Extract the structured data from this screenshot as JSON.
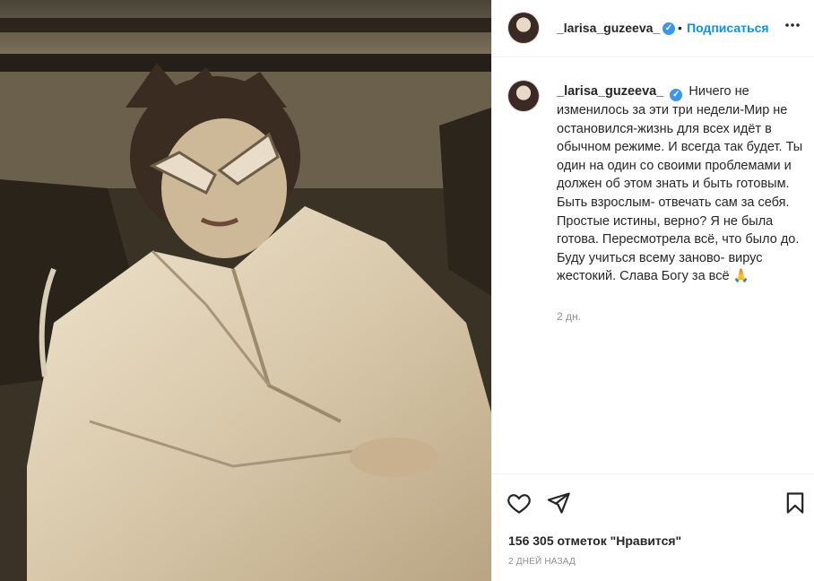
{
  "post": {
    "author": {
      "username": "_larisa_guzeeva_",
      "verified_glyph": "✓",
      "separator": "•",
      "follow_label": "Подписаться",
      "more_label": "•••"
    },
    "caption": {
      "username": "_larisa_guzeeva_",
      "text": "Ничего не изменилось за эти три недели-Мир не остановился-жизнь для всех идёт в обычном режиме. И всегда так будет. Ты один на один со своими проблемами и должен об этом знать и быть готовым. Быть взрослым- отвечать сам за себя. Простые истины, верно? Я не была готова. Пересмотрела всё, что было до. Буду учиться всему заново- вирус жестокий. Слава Богу за всё 🙏",
      "time_ago": "2 дн."
    },
    "actions": {
      "like_icon": "heart-icon",
      "share_icon": "paper-plane-icon",
      "save_icon": "bookmark-icon"
    },
    "likes_text": "156 305 отметок \"Нравится\"",
    "date_text": "2 дней назад"
  },
  "colors": {
    "accent": "#0095f6",
    "verified": "#3897f0",
    "muted": "#8e8e8e",
    "text": "#262626"
  }
}
